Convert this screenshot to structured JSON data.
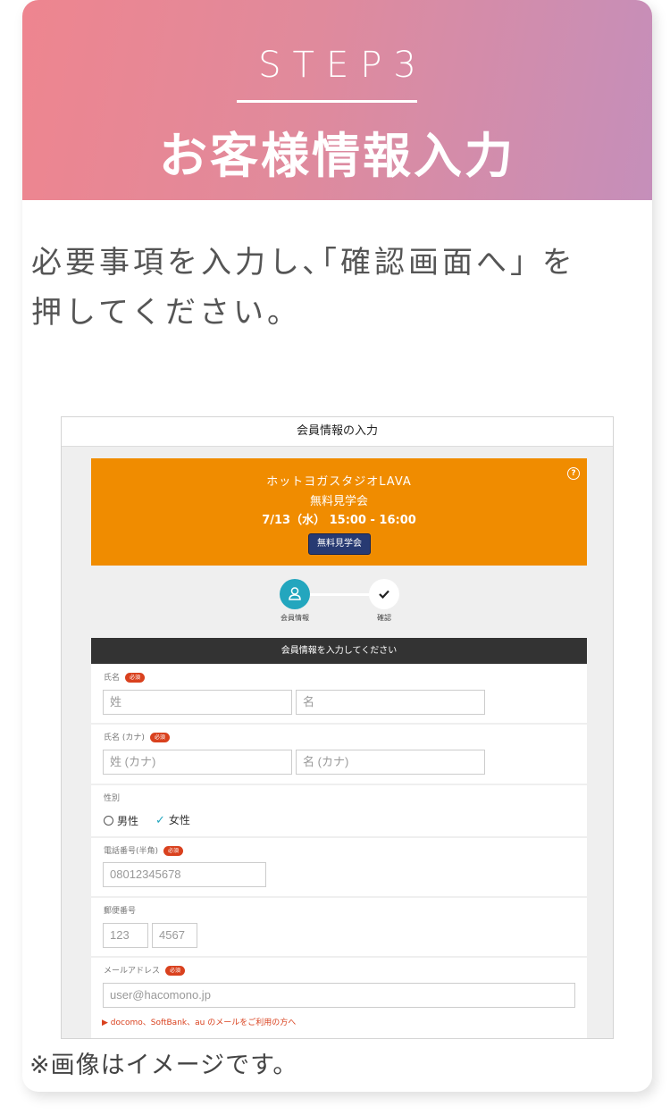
{
  "header": {
    "step": "STEP3",
    "title": "お客様情報入力"
  },
  "instruction": "必要事項を入力し､｢確認画面へ｣ を押してください。",
  "note": "※画像はイメージです。",
  "screenshot": {
    "title": "会員情報の入力",
    "banner": {
      "studio": "ホットヨガスタジオLAVA",
      "event": "無料見学会",
      "datetime": "7/13（水） 15:00 - 16:00",
      "button": "無料見学会",
      "help_icon": "?"
    },
    "stepper": {
      "step1": "会員情報",
      "step2": "確認"
    },
    "form_heading": "会員情報を入力してください",
    "required_badge": "必須",
    "fields": {
      "name": {
        "label": "氏名",
        "last_placeholder": "姓",
        "first_placeholder": "名"
      },
      "kana": {
        "label": "氏名 (カナ)",
        "last_placeholder": "姓 (カナ)",
        "first_placeholder": "名 (カナ)"
      },
      "gender": {
        "label": "性別",
        "male": "男性",
        "female": "女性"
      },
      "phone": {
        "label": "電話番号(半角)",
        "placeholder": "08012345678"
      },
      "postal": {
        "label": "郵便番号",
        "part1": "123",
        "part2": "4567"
      },
      "email": {
        "label": "メールアドレス",
        "placeholder": "user@hacomono.jp",
        "notice": "docomo、SoftBank、au のメールをご利用の方へ"
      }
    }
  },
  "colors": {
    "accent_orange": "#f08c00",
    "teal": "#23a6be",
    "required_red": "#d9411e",
    "header_gradient_start": "#ee858f",
    "header_gradient_end": "#c58fba"
  }
}
